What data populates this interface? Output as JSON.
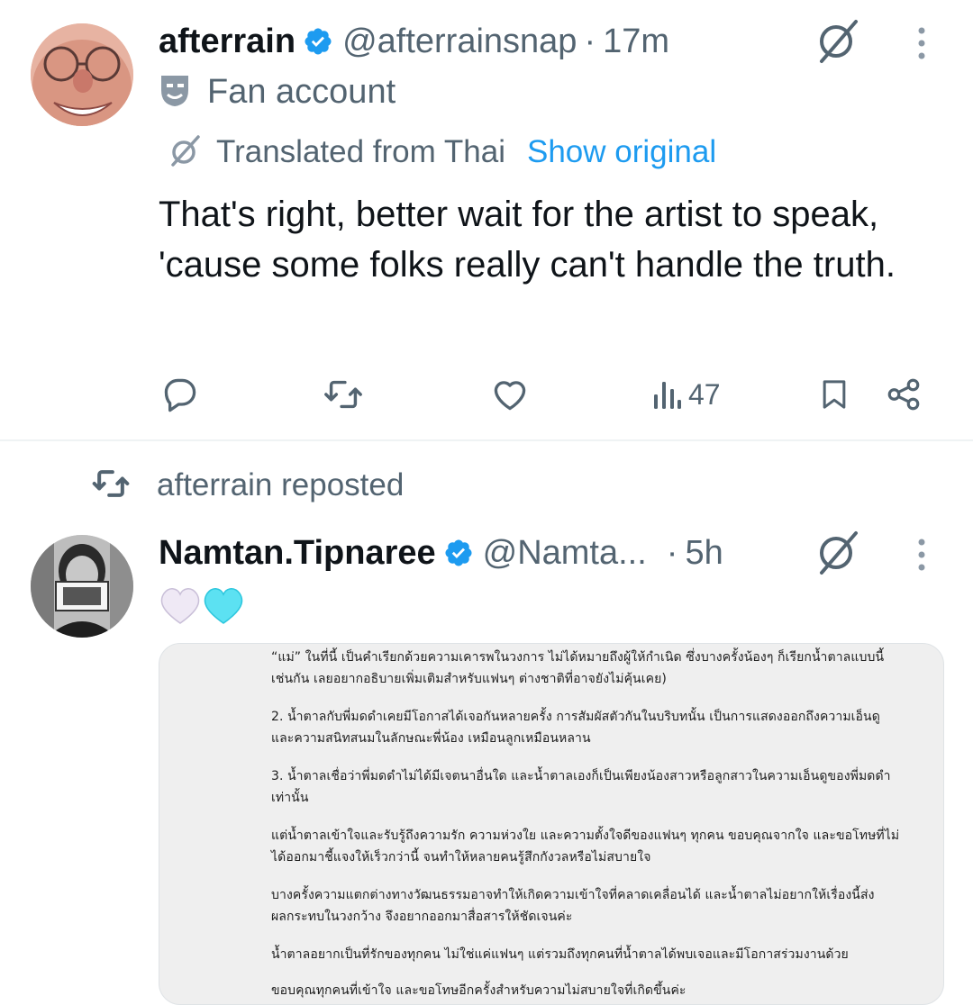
{
  "tweet1": {
    "display_name": "afterrain",
    "handle": "@afterrainsnap",
    "separator": "·",
    "time": "17m",
    "label": "Fan account",
    "translated_text": "Translated from Thai",
    "show_original": "Show original",
    "text": "That's right, better wait for the artist to speak, 'cause some folks really can't handle the truth.",
    "views": "47",
    "icons": {
      "verified": "verified-badge-icon",
      "grok": "grok-icon",
      "more": "more-vertical-icon",
      "label": "masks-icon",
      "reply": "reply-icon",
      "repost": "repost-icon",
      "like": "heart-icon",
      "views": "views-icon",
      "bookmark": "bookmark-icon",
      "share": "share-icon"
    }
  },
  "repost_line": {
    "text": "afterrain reposted"
  },
  "tweet2": {
    "display_name": "Namtan.Tipnaree",
    "handle": "@Namta...",
    "separator": "·",
    "time": "5h",
    "emoji": "🤍🩵",
    "media_lines": [
      "“แม่” ในที่นี้ เป็นคำเรียกด้วยความเคารพในวงการ ไม่ได้หมายถึงผู้ให้กำเนิด ซึ่งบางครั้งน้องๆ ก็เรียกน้ำตาลแบบนี้",
      "เช่นกัน เลยอยากอธิบายเพิ่มเติมสำหรับแฟนๆ ต่างชาติที่อาจยังไม่คุ้นเคย)",
      "2. น้ำตาลกับพี่มดดำเคยมีโอกาสได้เจอกันหลายครั้ง การสัมผัสตัวกันในบริบทนั้น เป็นการแสดงออกถึงความเอ็นดู",
      "และความสนิทสนมในลักษณะพี่น้อง เหมือนลูกเหมือนหลาน",
      "3. น้ำตาลเชื่อว่าพี่มดดำไม่ได้มีเจตนาอื่นใด และน้ำตาลเองก็เป็นเพียงน้องสาวหรือลูกสาวในความเอ็นดูของพี่มดดำ",
      "เท่านั้น",
      "แต่น้ำตาลเข้าใจและรับรู้ถึงความรัก ความห่วงใย และความตั้งใจดีของแฟนๆ ทุกคน ขอบคุณจากใจ และขอโทษที่ไม่",
      "ได้ออกมาชี้แจงให้เร็วกว่านี้ จนทำให้หลายคนรู้สึกกังวลหรือไม่สบายใจ",
      "บางครั้งความแตกต่างทางวัฒนธรรมอาจทำให้เกิดความเข้าใจที่คลาดเคลื่อนได้ และน้ำตาลไม่อยากให้เรื่องนี้ส่ง",
      "ผลกระทบในวงกว้าง จึงอยากออกมาสื่อสารให้ชัดเจนค่ะ",
      "น้ำตาลอยากเป็นที่รักของทุกคน ไม่ใช่แค่แฟนๆ แต่รวมถึงทุกคนที่น้ำตาลได้พบเจอและมีโอกาสร่วมงานด้วย",
      "ขอบคุณทุกคนที่เข้าใจ และขอโทษอีกครั้งสำหรับความไม่สบายใจที่เกิดขึ้นค่ะ"
    ]
  },
  "colors": {
    "text_primary": "#0f1419",
    "text_secondary": "#536471",
    "link": "#1d9bf0",
    "verified": "#1d9bf0",
    "divider": "#eff3f4"
  }
}
